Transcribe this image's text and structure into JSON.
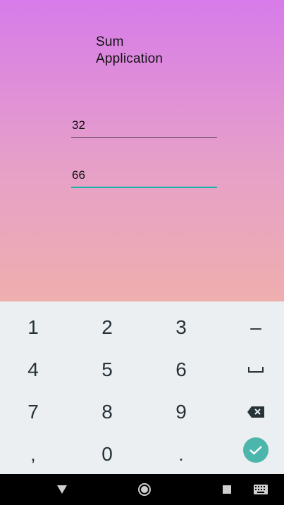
{
  "app": {
    "title_line1": "Sum",
    "title_line2": "Application",
    "fields": [
      {
        "value": "32"
      },
      {
        "value": "66"
      }
    ],
    "background_gradient": [
      "#d77bea",
      "#efaeae"
    ],
    "accent_color": "#19b3ae"
  },
  "keyboard": {
    "keys": [
      "1",
      "2",
      "3",
      "–",
      "4",
      "5",
      "6",
      "␣",
      "7",
      "8",
      "9",
      "backspace-icon",
      ",",
      "0",
      ".",
      "done-icon"
    ],
    "row1": [
      "1",
      "2",
      "3",
      "–"
    ],
    "row2": [
      "4",
      "5",
      "6"
    ],
    "row3": [
      "7",
      "8",
      "9"
    ],
    "row4": [
      ",",
      "0",
      "."
    ],
    "done_color": "#4db6ac"
  },
  "navbar": {
    "buttons": [
      "back-icon",
      "home-icon",
      "recents-icon",
      "keyboard-switch-icon"
    ]
  }
}
